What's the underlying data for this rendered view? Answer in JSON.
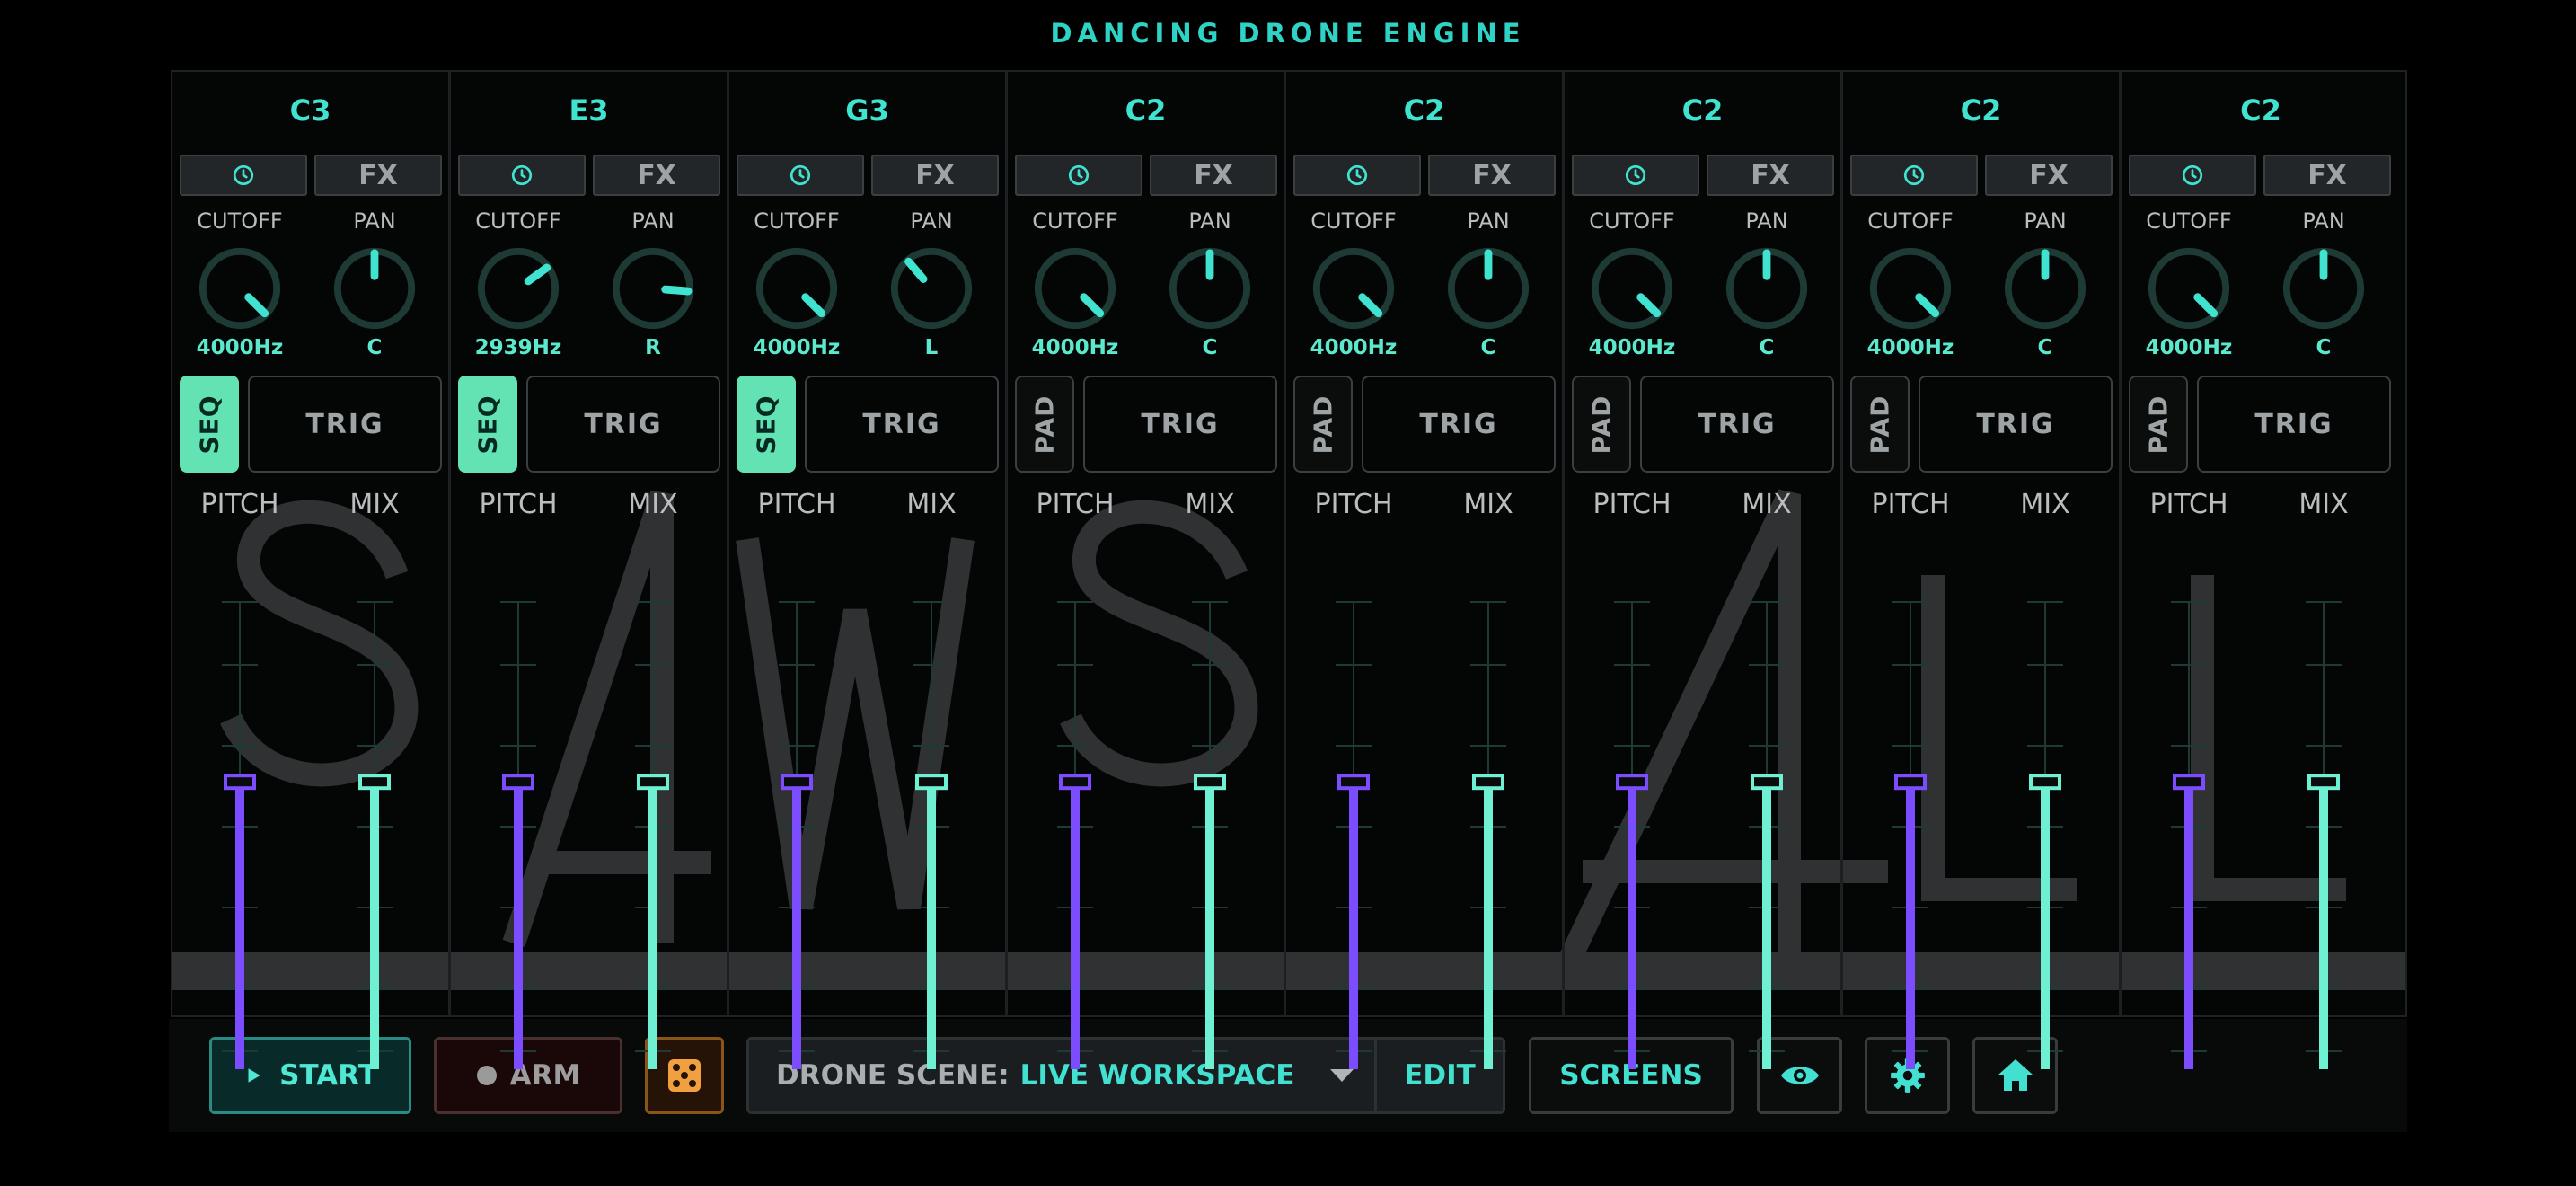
{
  "app": {
    "title": "DANCING DRONE ENGINE",
    "watermark": "SAWS ALL"
  },
  "labels": {
    "cutoff": "CUTOFF",
    "pan": "PAN",
    "pitch": "PITCH",
    "mix": "MIX",
    "fx": "FX",
    "trig": "TRIG"
  },
  "channels": [
    {
      "note": "C3",
      "cutoff_value": "4000Hz",
      "cutoff_level": 1.0,
      "pan_value": "C",
      "pan_position": 0.0,
      "mode": "SEQ",
      "pitch_level": 0.5,
      "mix_level": 0.5
    },
    {
      "note": "E3",
      "cutoff_value": "2939Hz",
      "cutoff_level": 0.7,
      "pan_value": "R",
      "pan_position": 0.7,
      "mode": "SEQ",
      "pitch_level": 0.5,
      "mix_level": 0.5
    },
    {
      "note": "G3",
      "cutoff_value": "4000Hz",
      "cutoff_level": 1.0,
      "pan_value": "L",
      "pan_position": -0.3,
      "mode": "SEQ",
      "pitch_level": 0.5,
      "mix_level": 0.5
    },
    {
      "note": "C2",
      "cutoff_value": "4000Hz",
      "cutoff_level": 1.0,
      "pan_value": "C",
      "pan_position": 0.0,
      "mode": "PAD",
      "pitch_level": 0.5,
      "mix_level": 0.5
    },
    {
      "note": "C2",
      "cutoff_value": "4000Hz",
      "cutoff_level": 1.0,
      "pan_value": "C",
      "pan_position": 0.0,
      "mode": "PAD",
      "pitch_level": 0.5,
      "mix_level": 0.5
    },
    {
      "note": "C2",
      "cutoff_value": "4000Hz",
      "cutoff_level": 1.0,
      "pan_value": "C",
      "pan_position": 0.0,
      "mode": "PAD",
      "pitch_level": 0.5,
      "mix_level": 0.5
    },
    {
      "note": "C2",
      "cutoff_value": "4000Hz",
      "cutoff_level": 1.0,
      "pan_value": "C",
      "pan_position": 0.0,
      "mode": "PAD",
      "pitch_level": 0.5,
      "mix_level": 0.5
    },
    {
      "note": "C2",
      "cutoff_value": "4000Hz",
      "cutoff_level": 1.0,
      "pan_value": "C",
      "pan_position": 0.0,
      "mode": "PAD",
      "pitch_level": 0.5,
      "mix_level": 0.5
    }
  ],
  "footer": {
    "start_label": "START",
    "arm_label": "ARM",
    "scene_prefix": "DRONE SCENE:",
    "scene_value": "LIVE WORKSPACE",
    "edit_label": "EDIT",
    "screens_label": "SCREENS",
    "icons": [
      "play-icon",
      "record-dot-icon",
      "dice-icon",
      "chevron-down-icon",
      "eye-icon",
      "gear-icon",
      "home-icon"
    ]
  },
  "colors": {
    "accent_teal": "#3fe3cf",
    "pitch_purple": "#7c4dff",
    "mix_teal": "#6ff0d2",
    "seq_green": "#63e3b3",
    "dice_orange": "#f0a040",
    "knob_track": "#1e3a35"
  }
}
